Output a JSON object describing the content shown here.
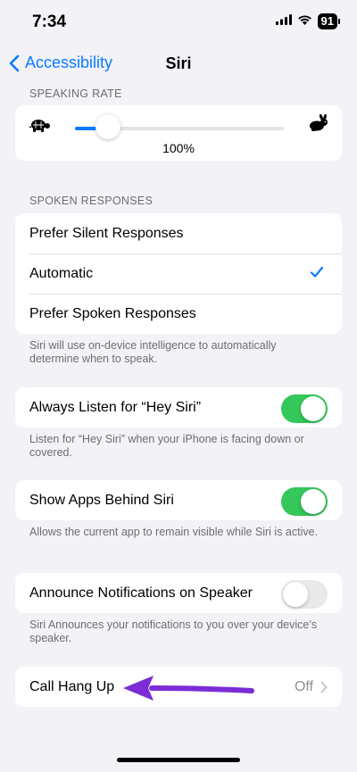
{
  "status": {
    "time": "7:34",
    "battery": "91"
  },
  "nav": {
    "back_label": "Accessibility",
    "title": "Siri"
  },
  "speaking_rate": {
    "header": "SPEAKING RATE",
    "value": "100%",
    "level_fraction": 0.16
  },
  "spoken_responses": {
    "header": "SPOKEN RESPONSES",
    "options": [
      {
        "label": "Prefer Silent Responses",
        "selected": false
      },
      {
        "label": "Automatic",
        "selected": true
      },
      {
        "label": "Prefer Spoken Responses",
        "selected": false
      }
    ],
    "footer": "Siri will use on-device intelligence to automatically determine when to speak."
  },
  "hey_siri": {
    "label": "Always Listen for “Hey Siri”",
    "on": true,
    "footer": "Listen for “Hey Siri” when your iPhone is facing down or covered."
  },
  "apps_behind": {
    "label": "Show Apps Behind Siri",
    "on": true,
    "footer": "Allows the current app to remain visible while Siri is active."
  },
  "announce": {
    "label": "Announce Notifications on Speaker",
    "on": false,
    "footer": "Siri Announces your notifications to you over your device’s speaker."
  },
  "call_hang_up": {
    "label": "Call Hang Up",
    "value": "Off"
  },
  "colors": {
    "accent": "#0a7aff",
    "toggle_on": "#34c759",
    "annotation_arrow": "#7b2cd6"
  }
}
